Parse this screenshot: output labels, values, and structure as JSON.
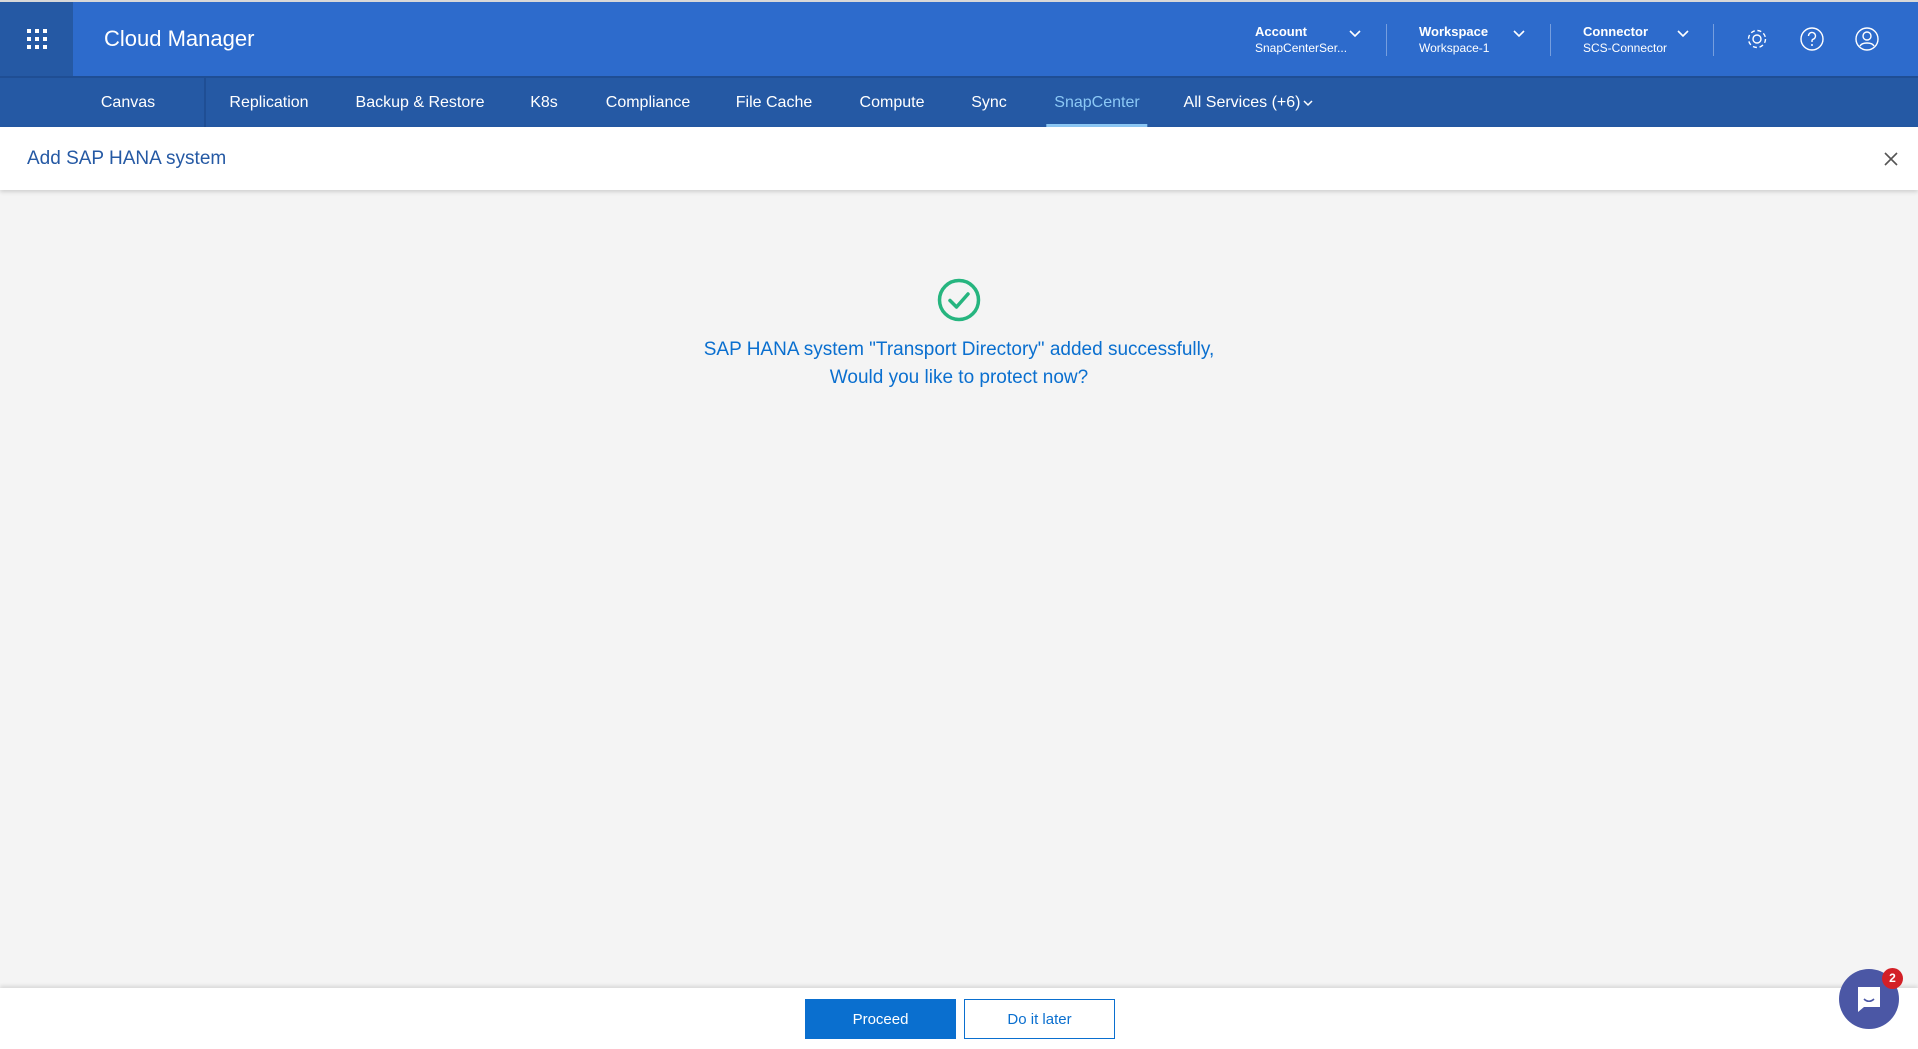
{
  "header": {
    "app_title": "Cloud Manager",
    "account": {
      "label": "Account",
      "value": "SnapCenterSer..."
    },
    "workspace": {
      "label": "Workspace",
      "value": "Workspace-1"
    },
    "connector": {
      "label": "Connector",
      "value": "SCS-Connector"
    }
  },
  "nav": {
    "items": [
      "Canvas",
      "Replication",
      "Backup & Restore",
      "K8s",
      "Compliance",
      "File Cache",
      "Compute",
      "Sync",
      "SnapCenter",
      "All Services (+6)"
    ],
    "active": "SnapCenter"
  },
  "page": {
    "title": "Add SAP HANA system"
  },
  "result": {
    "line1": "SAP HANA system \"Transport Directory\" added successfully,",
    "line2": "Would you like to protect now?"
  },
  "footer": {
    "proceed": "Proceed",
    "later": "Do it later"
  },
  "chat": {
    "badge": "2"
  },
  "colors": {
    "header": "#2d6bcc",
    "nav": "#2559a4",
    "accent": "#0a6fcf",
    "success": "#26b57f"
  }
}
